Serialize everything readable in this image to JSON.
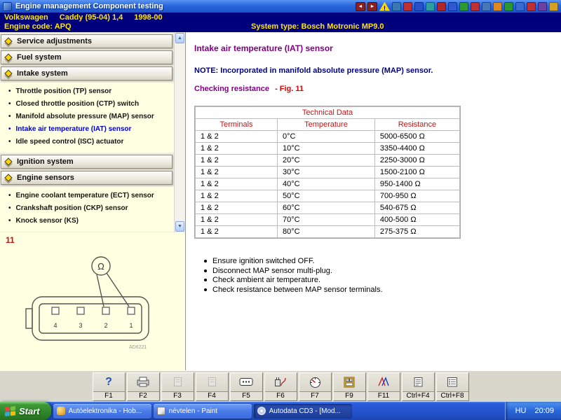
{
  "titlebar": {
    "title": "Engine management Component testing",
    "icons": [
      {
        "name": "nav-back-icon",
        "type": "nav",
        "glyph": "◄",
        "color": "#8a2020"
      },
      {
        "name": "nav-forward-icon",
        "type": "nav",
        "glyph": "►",
        "color": "#8a2020"
      },
      {
        "name": "warning-icon",
        "type": "warn"
      },
      {
        "name": "app-icon-1",
        "color": "#3a7ab0"
      },
      {
        "name": "app-icon-2",
        "color": "#c03030"
      },
      {
        "name": "app-icon-3",
        "color": "#2850c8"
      },
      {
        "name": "app-icon-4",
        "color": "#2e9e9e"
      },
      {
        "name": "app-icon-5",
        "color": "#b02828"
      },
      {
        "name": "app-icon-6",
        "color": "#3058d0"
      },
      {
        "name": "app-icon-7",
        "color": "#309830"
      },
      {
        "name": "app-icon-8",
        "color": "#c03030"
      },
      {
        "name": "app-icon-9",
        "color": "#4878b8"
      },
      {
        "name": "app-icon-10",
        "color": "#e08820"
      },
      {
        "name": "app-icon-11",
        "color": "#2e9830"
      },
      {
        "name": "app-icon-12",
        "color": "#3a6ad0"
      },
      {
        "name": "app-icon-13",
        "color": "#c03030"
      },
      {
        "name": "app-icon-14",
        "color": "#7040a0"
      },
      {
        "name": "app-icon-15",
        "color": "#d8a020"
      }
    ]
  },
  "header": {
    "brand": "Volkswagen",
    "model": "Caddy (95-04) 1,4",
    "years": "1998-00",
    "engine_code": "Engine code: APQ",
    "system_type": "System type: Bosch Motronic MP9.0"
  },
  "sidebar": {
    "sections": [
      {
        "label": "Service adjustments",
        "items": []
      },
      {
        "label": "Fuel system",
        "items": []
      },
      {
        "label": "Intake system",
        "items": [
          "Throttle position (TP) sensor",
          "Closed throttle position (CTP) switch",
          "Manifold absolute pressure (MAP) sensor",
          "Intake air temperature (IAT) sensor",
          "Idle speed control (ISC) actuator"
        ]
      },
      {
        "label": "Ignition system",
        "items": []
      },
      {
        "label": "Engine sensors",
        "items": [
          "Engine coolant temperature (ECT) sensor",
          "Crankshaft position (CKP) sensor",
          "Knock sensor (KS)"
        ]
      }
    ],
    "selected_item": "Intake air temperature (IAT) sensor"
  },
  "figure": {
    "number": "11",
    "meter_symbol": "Ω",
    "pin_labels": [
      "4",
      "3",
      "2",
      "1"
    ],
    "caption": "AD6221"
  },
  "main": {
    "title": "Intake air temperature (IAT) sensor",
    "note": "NOTE: Incorporated in manifold absolute pressure (MAP) sensor.",
    "check_label": "Checking resistance",
    "fig_ref": "- Fig. 11",
    "table": {
      "title": "Technical Data",
      "headers": [
        "Terminals",
        "Temperature",
        "Resistance"
      ],
      "rows": [
        [
          "1 & 2",
          "0°C",
          "5000-6500 Ω"
        ],
        [
          "1 & 2",
          "10°C",
          "3350-4400 Ω"
        ],
        [
          "1 & 2",
          "20°C",
          "2250-3000 Ω"
        ],
        [
          "1 & 2",
          "30°C",
          "1500-2100 Ω"
        ],
        [
          "1 & 2",
          "40°C",
          "950-1400 Ω"
        ],
        [
          "1 & 2",
          "50°C",
          "700-950 Ω"
        ],
        [
          "1 & 2",
          "60°C",
          "540-675 Ω"
        ],
        [
          "1 & 2",
          "70°C",
          "400-500 Ω"
        ],
        [
          "1 & 2",
          "80°C",
          "275-375 Ω"
        ]
      ]
    },
    "bullets": [
      "Ensure ignition switched OFF.",
      "Disconnect MAP sensor multi-plug.",
      "Check ambient air temperature.",
      "Check resistance between MAP sensor terminals."
    ]
  },
  "function_bar": {
    "buttons": [
      {
        "label": "F1",
        "icon": "help-icon",
        "enabled": true
      },
      {
        "label": "F2",
        "icon": "printer-icon",
        "enabled": true
      },
      {
        "label": "F3",
        "icon": "doc-icon",
        "enabled": false
      },
      {
        "label": "F4",
        "icon": "doc-icon",
        "enabled": false
      },
      {
        "label": "F5",
        "icon": "connector-icon",
        "enabled": true
      },
      {
        "label": "F6",
        "icon": "coil-icon",
        "enabled": true
      },
      {
        "label": "F7",
        "icon": "meter-icon",
        "enabled": true
      },
      {
        "label": "F9",
        "icon": "location-icon",
        "enabled": true
      },
      {
        "label": "F11",
        "icon": "wiring-icon",
        "enabled": true
      },
      {
        "label": "Ctrl+F4",
        "icon": "notes-icon",
        "enabled": true
      },
      {
        "label": "Ctrl+F8",
        "icon": "list-icon",
        "enabled": true
      }
    ]
  },
  "taskbar": {
    "start_label": "Start",
    "items": [
      {
        "label": "Autóelektronika - Hob...",
        "icon": "app-window-icon",
        "active": false
      },
      {
        "label": "névtelen - Paint",
        "icon": "paint-icon",
        "active": false
      },
      {
        "label": "Autodata CD3 - [Mod...",
        "icon": "cd-icon",
        "active": true
      }
    ],
    "tray": {
      "language": "HU",
      "time": "20:09"
    }
  }
}
